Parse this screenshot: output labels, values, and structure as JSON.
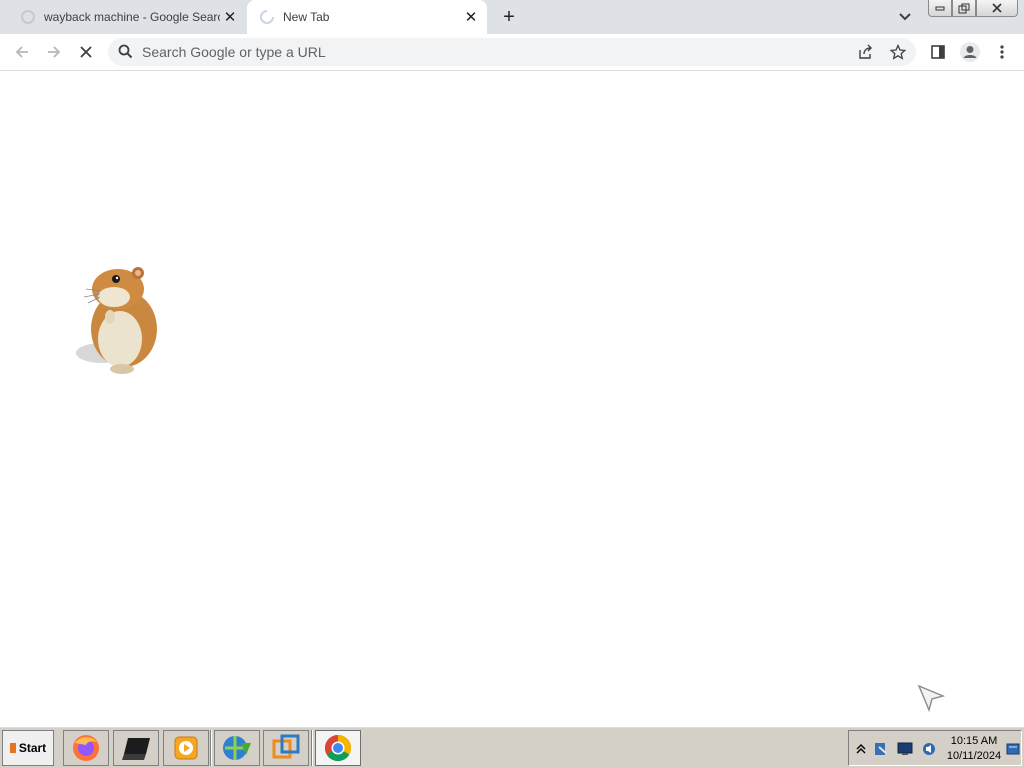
{
  "browser": {
    "tabs": [
      {
        "title": "wayback machine - Google Search",
        "active": false,
        "favicon": "google-favicon-icon"
      },
      {
        "title": "New Tab",
        "active": true,
        "favicon": "loading-spinner-icon"
      }
    ],
    "new_tab_label": "+",
    "window_controls": [
      "minimize-icon",
      "restore-icon",
      "close-icon"
    ]
  },
  "toolbar": {
    "omnibox_placeholder": "Search Google or type a URL",
    "omnibox_value": "",
    "buttons": [
      "back-icon",
      "forward-icon",
      "stop-loading-icon",
      "share-icon",
      "bookmark-star-icon",
      "side-panel-icon",
      "profile-icon",
      "menu-kebab-icon"
    ]
  },
  "content": {
    "image": "hamster-image"
  },
  "taskbar": {
    "start_label": "Start",
    "apps": [
      "firefox-icon",
      "terminal-icon",
      "media-player-icon",
      "internet-download-manager-icon",
      "virtual-machine-icon",
      "chrome-icon"
    ],
    "active_app": "chrome-icon",
    "tray_icons": [
      "show-hidden-icons-icon",
      "network-security-icon",
      "monitor-icon",
      "speaker-icon",
      "notification-flag-icon"
    ],
    "clock": {
      "time": "10:15 AM",
      "date": "10/11/2024"
    }
  },
  "colors": {
    "tabstrip_bg": "#dee1e6",
    "omnibox_bg": "#f1f3f4",
    "taskbar_bg": "#d4d0c8",
    "chrome_red": "#db4437",
    "chrome_yellow": "#f4b400",
    "chrome_green": "#0f9d58",
    "chrome_blue": "#4285f4"
  }
}
